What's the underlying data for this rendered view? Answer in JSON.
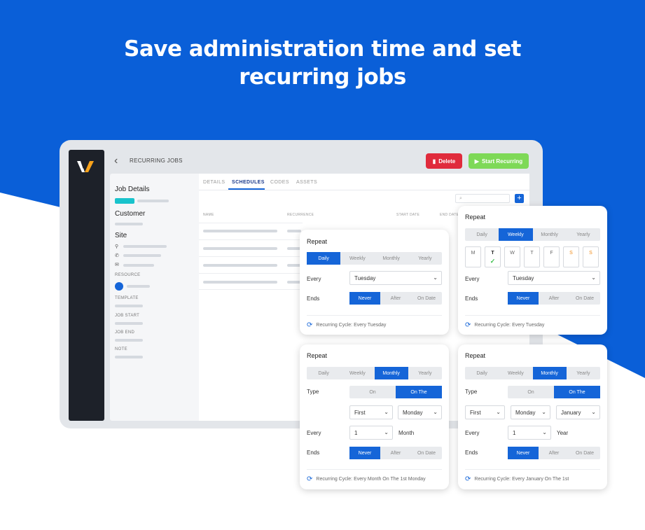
{
  "headline": {
    "line1": "Save administration time and set",
    "line2": "recurring jobs"
  },
  "colors": {
    "brand_blue": "#0a5fd8",
    "accent_teal": "#19c3cc",
    "delete_red": "#e02b3c",
    "start_green": "#7ed957",
    "active_blue": "#1565d8"
  },
  "app": {
    "breadcrumb": "RECURRING JOBS",
    "delete_label": "Delete",
    "start_label": "Start Recurring",
    "tabs": [
      "DETAILS",
      "SCHEDULES",
      "CODES",
      "ASSETS"
    ],
    "active_tab": "SCHEDULES",
    "table_headers": [
      "NAME",
      "RECURRENCE",
      "START DATE",
      "END DATE"
    ],
    "left": {
      "job_details": "Job Details",
      "customer": "Customer",
      "site": "Site",
      "resource": "RESOURCE",
      "template": "TEMPLATE",
      "job_start": "JOB START",
      "job_end": "JOB END",
      "note": "NOTE"
    }
  },
  "cards": {
    "daily": {
      "title": "Repeat",
      "modes": [
        "Daily",
        "Weekly",
        "Monthly",
        "Yearly"
      ],
      "active": "Daily",
      "every_label": "Every",
      "every_value": "Tuesday",
      "ends_label": "Ends",
      "ends_options": [
        "Never",
        "After",
        "On Date"
      ],
      "ends_active": "Never",
      "cycle": "Recurring Cycle: Every Tuesday"
    },
    "weekly": {
      "title": "Repeat",
      "modes": [
        "Daily",
        "Weekly",
        "Monthly",
        "Yearly"
      ],
      "active": "Weekly",
      "days": [
        "M",
        "T",
        "W",
        "T",
        "F",
        "S",
        "S"
      ],
      "selected_day_index": 1,
      "every_label": "Every",
      "every_value": "Tuesday",
      "ends_label": "Ends",
      "ends_options": [
        "Never",
        "After",
        "On Date"
      ],
      "ends_active": "Never",
      "cycle": "Recurring Cycle: Every Tuesday"
    },
    "monthly": {
      "title": "Repeat",
      "modes": [
        "Daily",
        "Weekly",
        "Monthly",
        "Yearly"
      ],
      "active": "Monthly",
      "type_label": "Type",
      "type_options": [
        "On",
        "On The"
      ],
      "type_active": "On The",
      "ordinal": "First",
      "weekday": "Monday",
      "every_label": "Every",
      "every_value": "1",
      "every_unit": "Month",
      "ends_label": "Ends",
      "ends_options": [
        "Never",
        "After",
        "On Date"
      ],
      "ends_active": "Never",
      "cycle": "Recurring Cycle: Every Month On The 1st Monday"
    },
    "yearly": {
      "title": "Repeat",
      "modes": [
        "Daily",
        "Weekly",
        "Monthly",
        "Yearly"
      ],
      "active": "Monthly",
      "type_label": "Type",
      "type_options": [
        "On",
        "On The"
      ],
      "type_active": "On The",
      "ordinal": "First",
      "weekday": "Monday",
      "month": "January",
      "every_label": "Every",
      "every_value": "1",
      "every_unit": "Year",
      "ends_label": "Ends",
      "ends_options": [
        "Never",
        "After",
        "On Date"
      ],
      "ends_active": "Never",
      "cycle": "Recurring Cycle: Every January On The 1st"
    }
  }
}
